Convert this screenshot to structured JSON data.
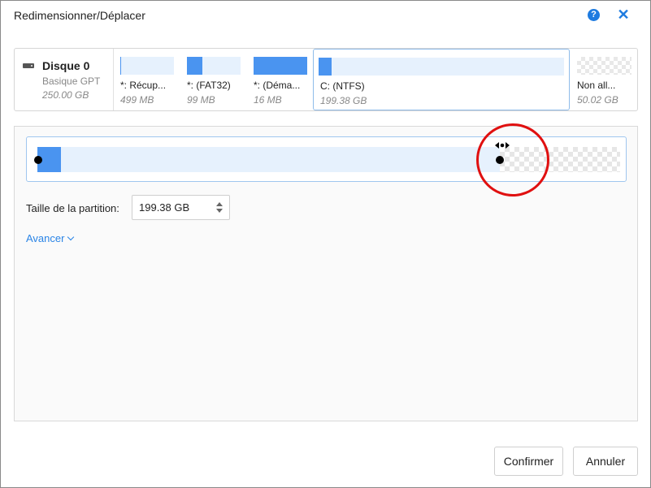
{
  "window": {
    "title": "Redimensionner/Déplacer"
  },
  "titlebar_icons": {
    "help": "?",
    "close": "✕"
  },
  "disk": {
    "name": "Disque 0",
    "type": "Basique GPT",
    "size": "250.00 GB"
  },
  "partitions": [
    {
      "label": "*: Récup...",
      "size": "499 MB",
      "used_fraction": 0.0
    },
    {
      "label": "*:  (FAT32)",
      "size": "99 MB",
      "used_fraction": 0.3
    },
    {
      "label": "*:  (Déma...",
      "size": "16 MB",
      "used_fraction": 1.0
    },
    {
      "label": "C:  (NTFS)",
      "size": "199.38 GB",
      "used_fraction": 0.05,
      "selected": true
    },
    {
      "label": "Non all...",
      "size": "50.02 GB",
      "unallocated": true
    }
  ],
  "resize": {
    "partition_size_label": "Taille de la partition:",
    "partition_size_value": "199.38 GB",
    "advanced_label": "Avancer"
  },
  "buttons": {
    "confirm": "Confirmer",
    "cancel": "Annuler"
  },
  "colors": {
    "accent": "#1e7be0",
    "partition_fill": "#4a94f0",
    "partition_free": "#e6f1fd",
    "highlight": "#e01010"
  }
}
